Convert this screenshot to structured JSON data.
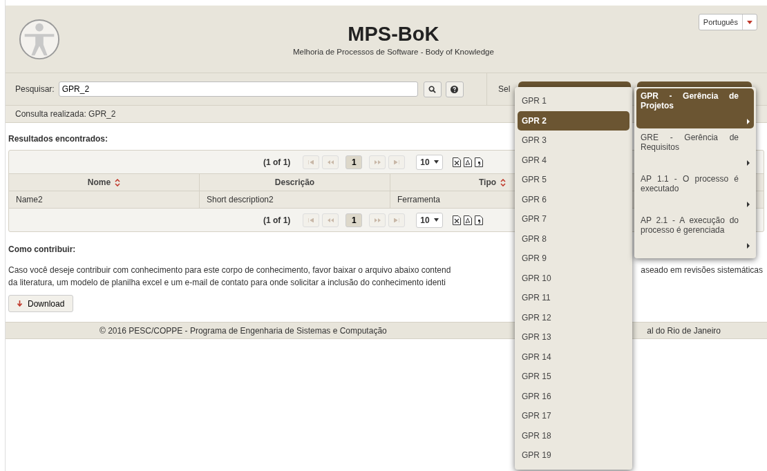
{
  "header": {
    "title": "MPS-BoK",
    "subtitle": "Melhoria de Processos de Software - Body of Knowledge",
    "language": "Português"
  },
  "search": {
    "label": "Pesquisar:",
    "value": "GPR_2",
    "select_label_fragment": "Sel"
  },
  "query_info": "Consulta realizada: GPR_2",
  "results": {
    "title": "Resultados encontrados:",
    "paginators": [
      {
        "summary": "(1 of 1)",
        "page": "1",
        "rows_per_page": "10"
      },
      {
        "summary": "(1 of 1)",
        "page": "1",
        "rows_per_page": "10"
      }
    ],
    "columns": [
      {
        "label": "Nome",
        "sortable": true
      },
      {
        "label": "Descrição",
        "sortable": false
      },
      {
        "label": "Tipo",
        "sortable": true
      }
    ],
    "rows": [
      [
        "Name2",
        "Short description2",
        "Ferramenta"
      ]
    ]
  },
  "contribute": {
    "title": "Como contribuir:",
    "lines": [
      {
        "left": "Caso você deseje contribuir com conhecimento para este corpo de conhecimento, favor baixar o arquivo abaixo contend",
        "right": "aseado em revisões sistemáticas"
      },
      {
        "left": "da literatura, um modelo de planilha excel e um e-mail de contato para onde solicitar a inclusão do conhecimento identi"
      }
    ],
    "download": "Download"
  },
  "footer": {
    "left": "© 2016 PESC/COPPE - Programa de Engenharia de Sistemas e Computação",
    "right": "al do Rio de Janeiro"
  },
  "item_menu": [
    {
      "label": "GPR 1",
      "selected": false
    },
    {
      "label": "GPR 2",
      "selected": true
    },
    {
      "label": "GPR 3",
      "selected": false
    },
    {
      "label": "GPR 4",
      "selected": false
    },
    {
      "label": "GPR 5",
      "selected": false
    },
    {
      "label": "GPR 6",
      "selected": false
    },
    {
      "label": "GPR 7",
      "selected": false
    },
    {
      "label": "GPR 8",
      "selected": false
    },
    {
      "label": "GPR 9",
      "selected": false
    },
    {
      "label": "GPR 10",
      "selected": false
    },
    {
      "label": "GPR 11",
      "selected": false
    },
    {
      "label": "GPR 12",
      "selected": false
    },
    {
      "label": "GPR 13",
      "selected": false
    },
    {
      "label": "GPR 14",
      "selected": false
    },
    {
      "label": "GPR 15",
      "selected": false
    },
    {
      "label": "GPR 16",
      "selected": false
    },
    {
      "label": "GPR 17",
      "selected": false
    },
    {
      "label": "GPR 18",
      "selected": false
    },
    {
      "label": "GPR 19",
      "selected": false
    }
  ],
  "process_menu": [
    {
      "label": "GPR - Gerência de Projetos",
      "selected": true
    },
    {
      "label": "GRE - Gerência de Requisitos",
      "selected": false
    },
    {
      "label": "AP 1.1 - O processo é executado",
      "selected": false
    },
    {
      "label": "AP 2.1 - A execução do processo é gerenciada",
      "selected": false
    }
  ]
}
